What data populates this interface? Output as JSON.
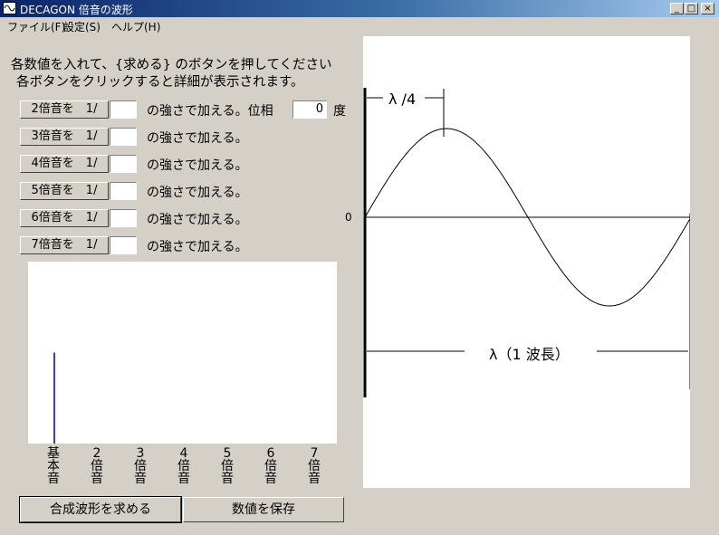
{
  "window": {
    "title": "DECAGON  倍音の波形",
    "minimize": "_",
    "maximize": "□",
    "close": "×"
  },
  "menu": [
    "ファイル(F)",
    "設定(S)",
    "ヘルプ(H)"
  ],
  "instructions": {
    "line1": "各数値を入れて、{求める} のボタンを押してください",
    "line2": "各ボタンをクリックすると詳細が表示されます。"
  },
  "harmonics": [
    {
      "button": "2倍音を　1/",
      "value": "",
      "suffix": "の強さで加える。位相"
    },
    {
      "button": "3倍音を　1/",
      "value": "",
      "suffix": "の強さで加える。"
    },
    {
      "button": "4倍音を　1/",
      "value": "",
      "suffix": "の強さで加える。"
    },
    {
      "button": "5倍音を　1/",
      "value": "",
      "suffix": "の強さで加える。"
    },
    {
      "button": "6倍音を　1/",
      "value": "",
      "suffix": "の強さで加える。"
    },
    {
      "button": "7倍音を　1/",
      "value": "",
      "suffix": "の強さで加える。"
    }
  ],
  "phase": {
    "value": "0",
    "unit": "度"
  },
  "spectrum": {
    "columns": [
      {
        "label": "基本音",
        "level": 0.5
      },
      {
        "label": "2倍音",
        "level": 0
      },
      {
        "label": "3倍音",
        "level": 0
      },
      {
        "label": "4倍音",
        "level": 0
      },
      {
        "label": "5倍音",
        "level": 0
      },
      {
        "label": "6倍音",
        "level": 0
      },
      {
        "label": "7倍音",
        "level": 0
      }
    ],
    "bar_color": "#000080"
  },
  "buttons": {
    "compute": "合成波形を求める",
    "save": "数値を保存"
  },
  "waveform": {
    "zero_label": "0",
    "quarter_label": "λ /4",
    "wavelength_label": "λ（1 波長）"
  }
}
